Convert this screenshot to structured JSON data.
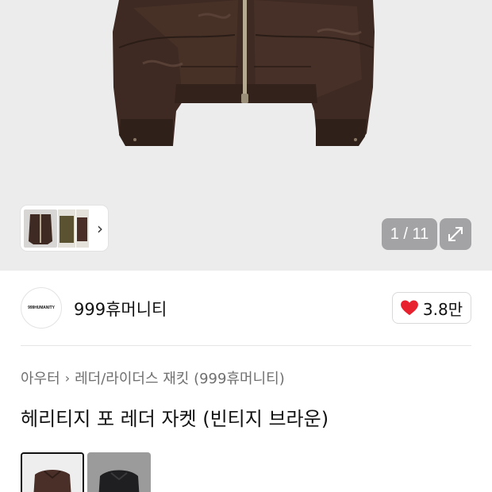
{
  "gallery": {
    "counter": "1 / 11",
    "thumbnails": [
      "leather-jacket-brown",
      "bomber-jacket-olive",
      "leather-jacket-brown-alt"
    ],
    "chevron_icon": "chevron-right-icon",
    "expand_icon": "expand-arrows-icon",
    "current_index": 1,
    "total": 11
  },
  "brand": {
    "logo_text": "999HUMANITY",
    "name": "999휴머니티",
    "like_icon": "heart-icon",
    "like_count": "3.8만",
    "like_color": "#e8212f"
  },
  "breadcrumb": {
    "category": "아우터",
    "subcategory": "레더/라이더스 재킷 (999휴머니티)"
  },
  "product": {
    "title": "헤리티지 포 레더 자켓 (빈티지 브라운)"
  },
  "colors": {
    "options": [
      "vintage-brown",
      "black"
    ],
    "selected": "vintage-brown"
  }
}
